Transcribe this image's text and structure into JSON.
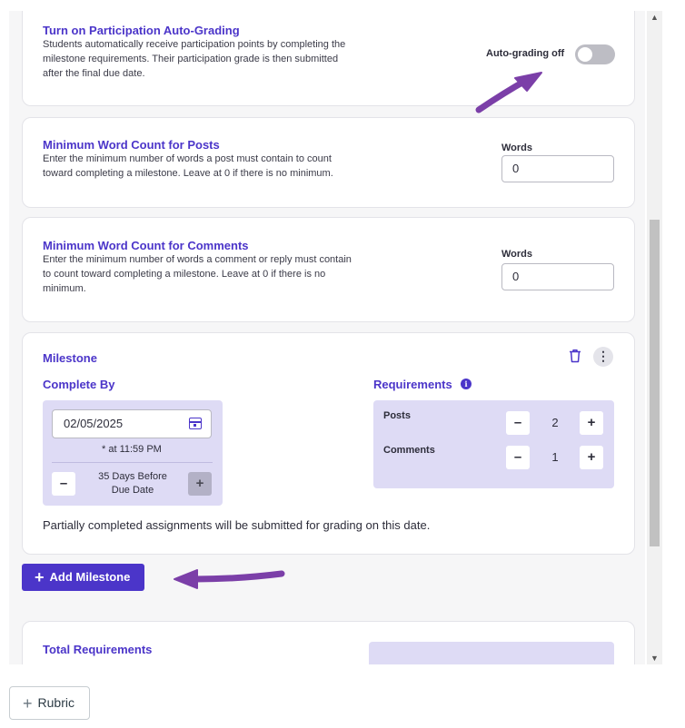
{
  "auto_grading": {
    "title": "Turn on Participation Auto-Grading",
    "description": "Students automatically receive participation points by completing the milestone requirements. Their participation grade is then submitted after the final due date.",
    "toggle_label": "Auto-grading off",
    "enabled": false
  },
  "min_posts": {
    "title": "Minimum Word Count for Posts",
    "description": "Enter the minimum number of words a post must contain to count toward completing a milestone. Leave at 0 if there is no minimum.",
    "field_label": "Words",
    "value": "0"
  },
  "min_comments": {
    "title": "Minimum Word Count for Comments",
    "description": "Enter the minimum number of words a comment or reply must contain to count toward completing a milestone. Leave at 0 if there is no minimum.",
    "field_label": "Words",
    "value": "0"
  },
  "milestone": {
    "title": "Milestone",
    "complete_by_label": "Complete By",
    "date": "02/05/2025",
    "time_note": "*  at 11:59 PM",
    "days_before_line1": "35 Days Before",
    "days_before_line2": "Due Date",
    "minus": "–",
    "plus": "+",
    "requirements_label": "Requirements",
    "info_glyph": "i",
    "requirements": [
      {
        "label": "Posts",
        "value": "2"
      },
      {
        "label": "Comments",
        "value": "1"
      }
    ],
    "note": "Partially completed assignments will be submitted for grading on this date.",
    "more_glyph": "⋮"
  },
  "add_milestone": {
    "plus": "+",
    "label": "Add Milestone"
  },
  "total_requirements": {
    "title": "Total Requirements"
  },
  "rubric_button": {
    "plus": "+",
    "label": "Rubric"
  },
  "scrollbar": {
    "up": "▲",
    "down": "▼"
  },
  "colors": {
    "accent": "#4b35c9",
    "panel": "#dedbf5",
    "annotation_arrow": "#7b3fa8"
  }
}
